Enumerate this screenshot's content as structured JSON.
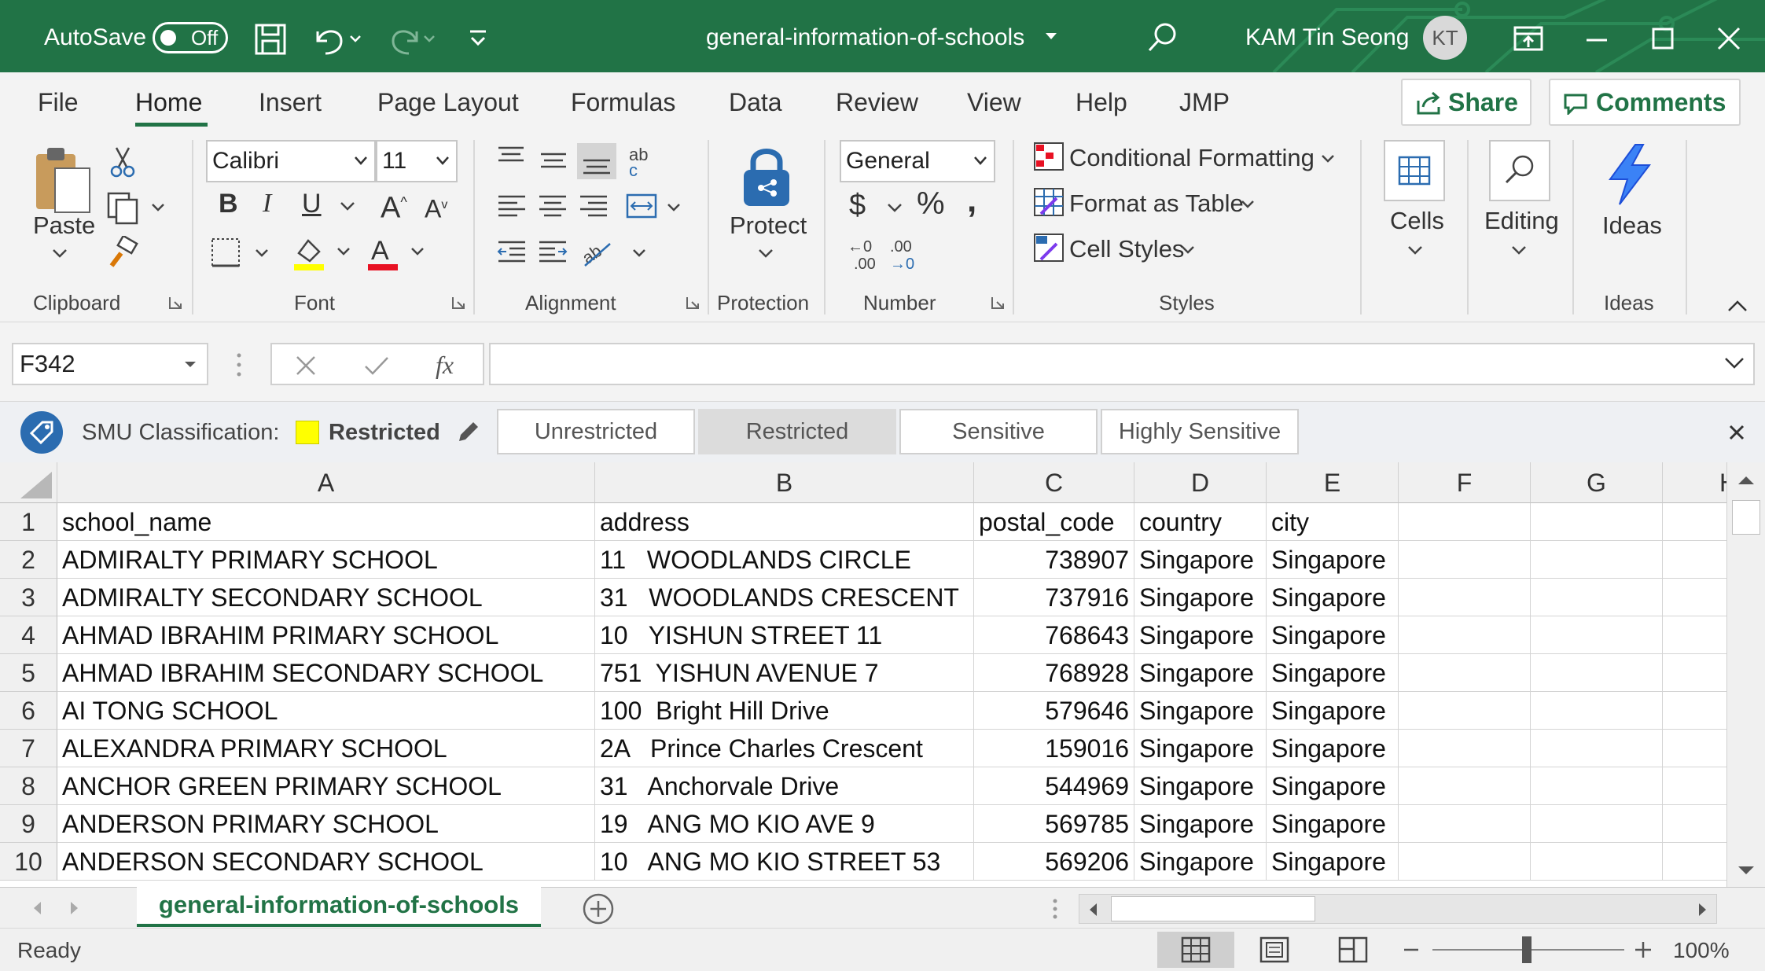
{
  "titlebar": {
    "autosave_label": "AutoSave",
    "autosave_state": "Off",
    "document_title": "general-information-of-schools",
    "user_name": "KAM Tin Seong",
    "user_initials": "KT",
    "background_color": "#217346"
  },
  "ribbon_tabs": [
    "File",
    "Home",
    "Insert",
    "Page Layout",
    "Formulas",
    "Data",
    "Review",
    "View",
    "Help",
    "JMP"
  ],
  "active_tab": "Home",
  "share_label": "Share",
  "comments_label": "Comments",
  "ribbon": {
    "clipboard": {
      "paste_label": "Paste",
      "group_label": "Clipboard"
    },
    "font": {
      "font_name": "Calibri",
      "font_size": "11",
      "group_label": "Font",
      "highlight_color": "#ffff00",
      "font_color": "#e81123"
    },
    "alignment": {
      "group_label": "Alignment"
    },
    "protection": {
      "protect_label": "Protect",
      "group_label": "Protection"
    },
    "number": {
      "format": "General",
      "group_label": "Number"
    },
    "styles": {
      "conditional_formatting": "Conditional Formatting",
      "format_as_table": "Format as Table",
      "cell_styles": "Cell Styles",
      "group_label": "Styles"
    },
    "cells": {
      "label": "Cells"
    },
    "editing": {
      "label": "Editing"
    },
    "ideas": {
      "label": "Ideas",
      "group_label": "Ideas"
    }
  },
  "formula_bar": {
    "name_box": "F342",
    "fx_label": "fx",
    "formula": ""
  },
  "classification": {
    "label": "SMU Classification:",
    "current": "Restricted",
    "current_color": "#ffff00",
    "options": [
      "Unrestricted",
      "Restricted",
      "Sensitive",
      "Highly Sensitive"
    ],
    "selected_option": "Restricted"
  },
  "sheet": {
    "column_headers": [
      "A",
      "B",
      "C",
      "D",
      "E",
      "F",
      "G",
      "H"
    ],
    "row_numbers": [
      "1",
      "2",
      "3",
      "4",
      "5",
      "6",
      "7",
      "8",
      "9",
      "10"
    ],
    "rows": [
      [
        "school_name",
        "address",
        "postal_code",
        "country",
        "city"
      ],
      [
        "ADMIRALTY PRIMARY SCHOOL",
        "11   WOODLANDS CIRCLE",
        "738907",
        "Singapore",
        "Singapore"
      ],
      [
        "ADMIRALTY SECONDARY SCHOOL",
        "31   WOODLANDS CRESCENT",
        "737916",
        "Singapore",
        "Singapore"
      ],
      [
        "AHMAD IBRAHIM PRIMARY SCHOOL",
        "10   YISHUN STREET 11",
        "768643",
        "Singapore",
        "Singapore"
      ],
      [
        "AHMAD IBRAHIM SECONDARY SCHOOL",
        "751  YISHUN AVENUE 7",
        "768928",
        "Singapore",
        "Singapore"
      ],
      [
        "AI TONG SCHOOL",
        "100  Bright Hill Drive",
        "579646",
        "Singapore",
        "Singapore"
      ],
      [
        "ALEXANDRA PRIMARY SCHOOL",
        "2A   Prince Charles Crescent",
        "159016",
        "Singapore",
        "Singapore"
      ],
      [
        "ANCHOR GREEN PRIMARY SCHOOL",
        "31   Anchorvale Drive",
        "544969",
        "Singapore",
        "Singapore"
      ],
      [
        "ANDERSON PRIMARY SCHOOL",
        "19   ANG MO KIO AVE 9",
        "569785",
        "Singapore",
        "Singapore"
      ],
      [
        "ANDERSON SECONDARY SCHOOL",
        "10   ANG MO KIO STREET 53",
        "569206",
        "Singapore",
        "Singapore"
      ]
    ],
    "tab_name": "general-information-of-schools"
  },
  "statusbar": {
    "status": "Ready",
    "zoom": "100%"
  }
}
